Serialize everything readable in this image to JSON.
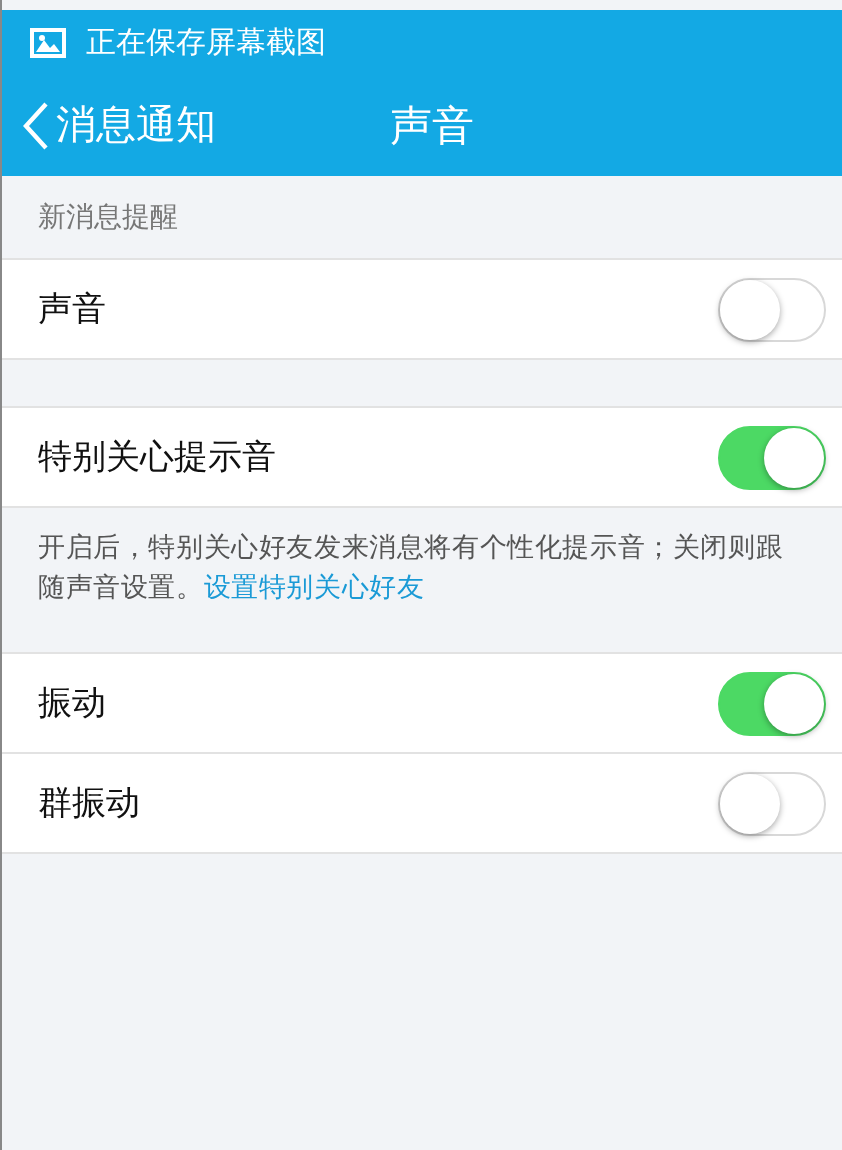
{
  "status_bar": {
    "text": "正在保存屏幕截图"
  },
  "nav": {
    "back_label": "消息通知",
    "title": "声音"
  },
  "sections": [
    {
      "header": "新消息提醒",
      "rows": [
        {
          "label": "声音",
          "on": false
        }
      ]
    },
    {
      "rows": [
        {
          "label": "特别关心提示音",
          "on": true
        }
      ],
      "note": {
        "text": "开启后，特别关心好友发来消息将有个性化提示音；关闭则跟随声音设置。",
        "link": "设置特别关心好友"
      }
    },
    {
      "rows": [
        {
          "label": "振动",
          "on": true
        },
        {
          "label": "群振动",
          "on": false
        }
      ]
    }
  ]
}
